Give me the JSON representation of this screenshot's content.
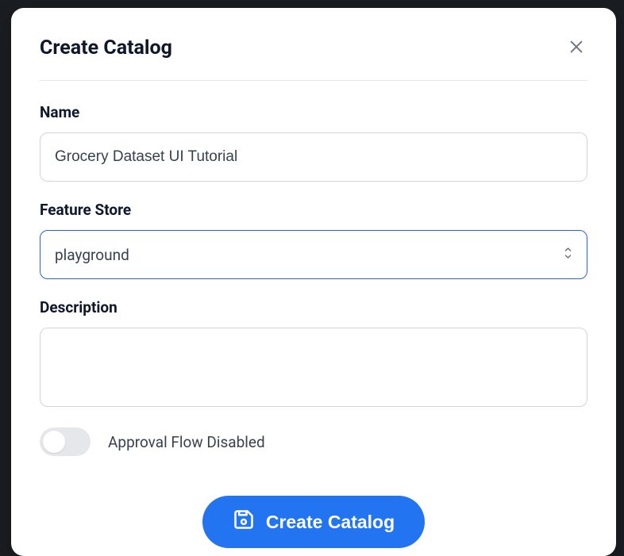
{
  "modal": {
    "title": "Create Catalog",
    "fields": {
      "name": {
        "label": "Name",
        "value": "Grocery Dataset UI Tutorial"
      },
      "feature_store": {
        "label": "Feature Store",
        "value": "playground"
      },
      "description": {
        "label": "Description",
        "value": ""
      }
    },
    "toggle": {
      "label": "Approval Flow Disabled",
      "enabled": false
    },
    "submit_label": "Create Catalog"
  }
}
